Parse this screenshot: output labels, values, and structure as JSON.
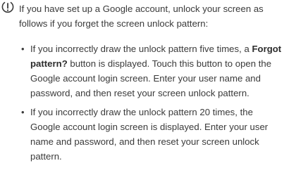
{
  "note": {
    "icon": "exclamation-circle-icon",
    "intro": "If you have set up a Google account, unlock your screen as follows if you forget the screen unlock pattern:",
    "bullet_symbol": "•",
    "items": [
      {
        "before": "If you incorrectly draw the unlock pattern five times, a ",
        "bold": "Forgot pattern?",
        "after": " button is displayed. Touch this button to open the Google account login screen. Enter your user name and password, and then reset your screen unlock pattern."
      },
      {
        "text": "If you incorrectly draw the unlock pattern 20 times, the Google account login screen is displayed. Enter your user name and password, and then reset your screen unlock pattern."
      }
    ]
  }
}
